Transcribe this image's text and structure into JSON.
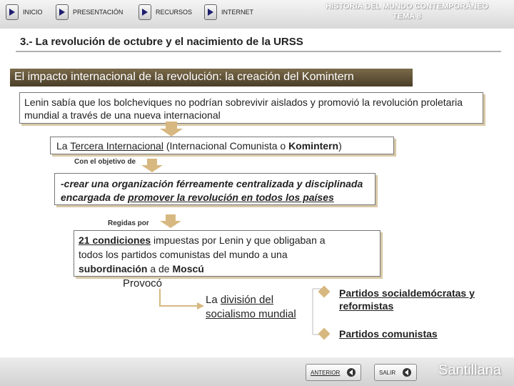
{
  "nav": {
    "inicio": "INICIO",
    "presentacion": "PRESENTACIÓN",
    "recursos": "RECURSOS",
    "internet": "INTERNET"
  },
  "header": {
    "title_line1": "HISTORIA DEL MUNDO CONTEMPORÁNEO",
    "title_line2": "TEMA 8"
  },
  "section": {
    "title": "3.- La revolución de octubre y el nacimiento de la URSS"
  },
  "banner": {
    "text": "El impacto internacional de la revolución: la creación del Komintern"
  },
  "box1": {
    "text": "Lenin sabía que los bolcheviques no podrían sobrevivir aislados y promovió la revolución proletaria mundial a través de una nueva internacional"
  },
  "box2": {
    "prefix": "La ",
    "term": "Tercera Internacional",
    "middle": " (Internacional Comunista o ",
    "term2": "Komintern",
    "suffix": ")"
  },
  "labels": {
    "con_objetivo": "Con el objetivo de",
    "regidas_por": "Regidas por",
    "provoco": "Provocó"
  },
  "box3": {
    "prefix": "-crear una organización férreamente centralizada y disciplinada encargada de ",
    "underlined": "promover la revolución en todos los países"
  },
  "box4": {
    "term": "21 condiciones",
    "line1_rest": " impuestas por Lenin y que obligaban a",
    "line2": "todos los partidos comunistas del mundo a una",
    "term2": "subordinación",
    "line3_mid": " a de ",
    "term3": "Moscú"
  },
  "division": {
    "prefix": "La ",
    "term": "división del ",
    "line2": "socialismo mundial"
  },
  "branches": {
    "b1_line1": "Partidos socialdemócratas y",
    "b1_line2": "reformistas",
    "b2": "Partidos comunistas"
  },
  "footer": {
    "anterior": "ANTERIOR",
    "salir": "SALIR",
    "brand": "Santillana"
  },
  "colors": {
    "banner": "#5e5036",
    "shadow": "#d8c9a8",
    "arrow": "#d7b880",
    "nav_icon": "#1e1e6e"
  }
}
